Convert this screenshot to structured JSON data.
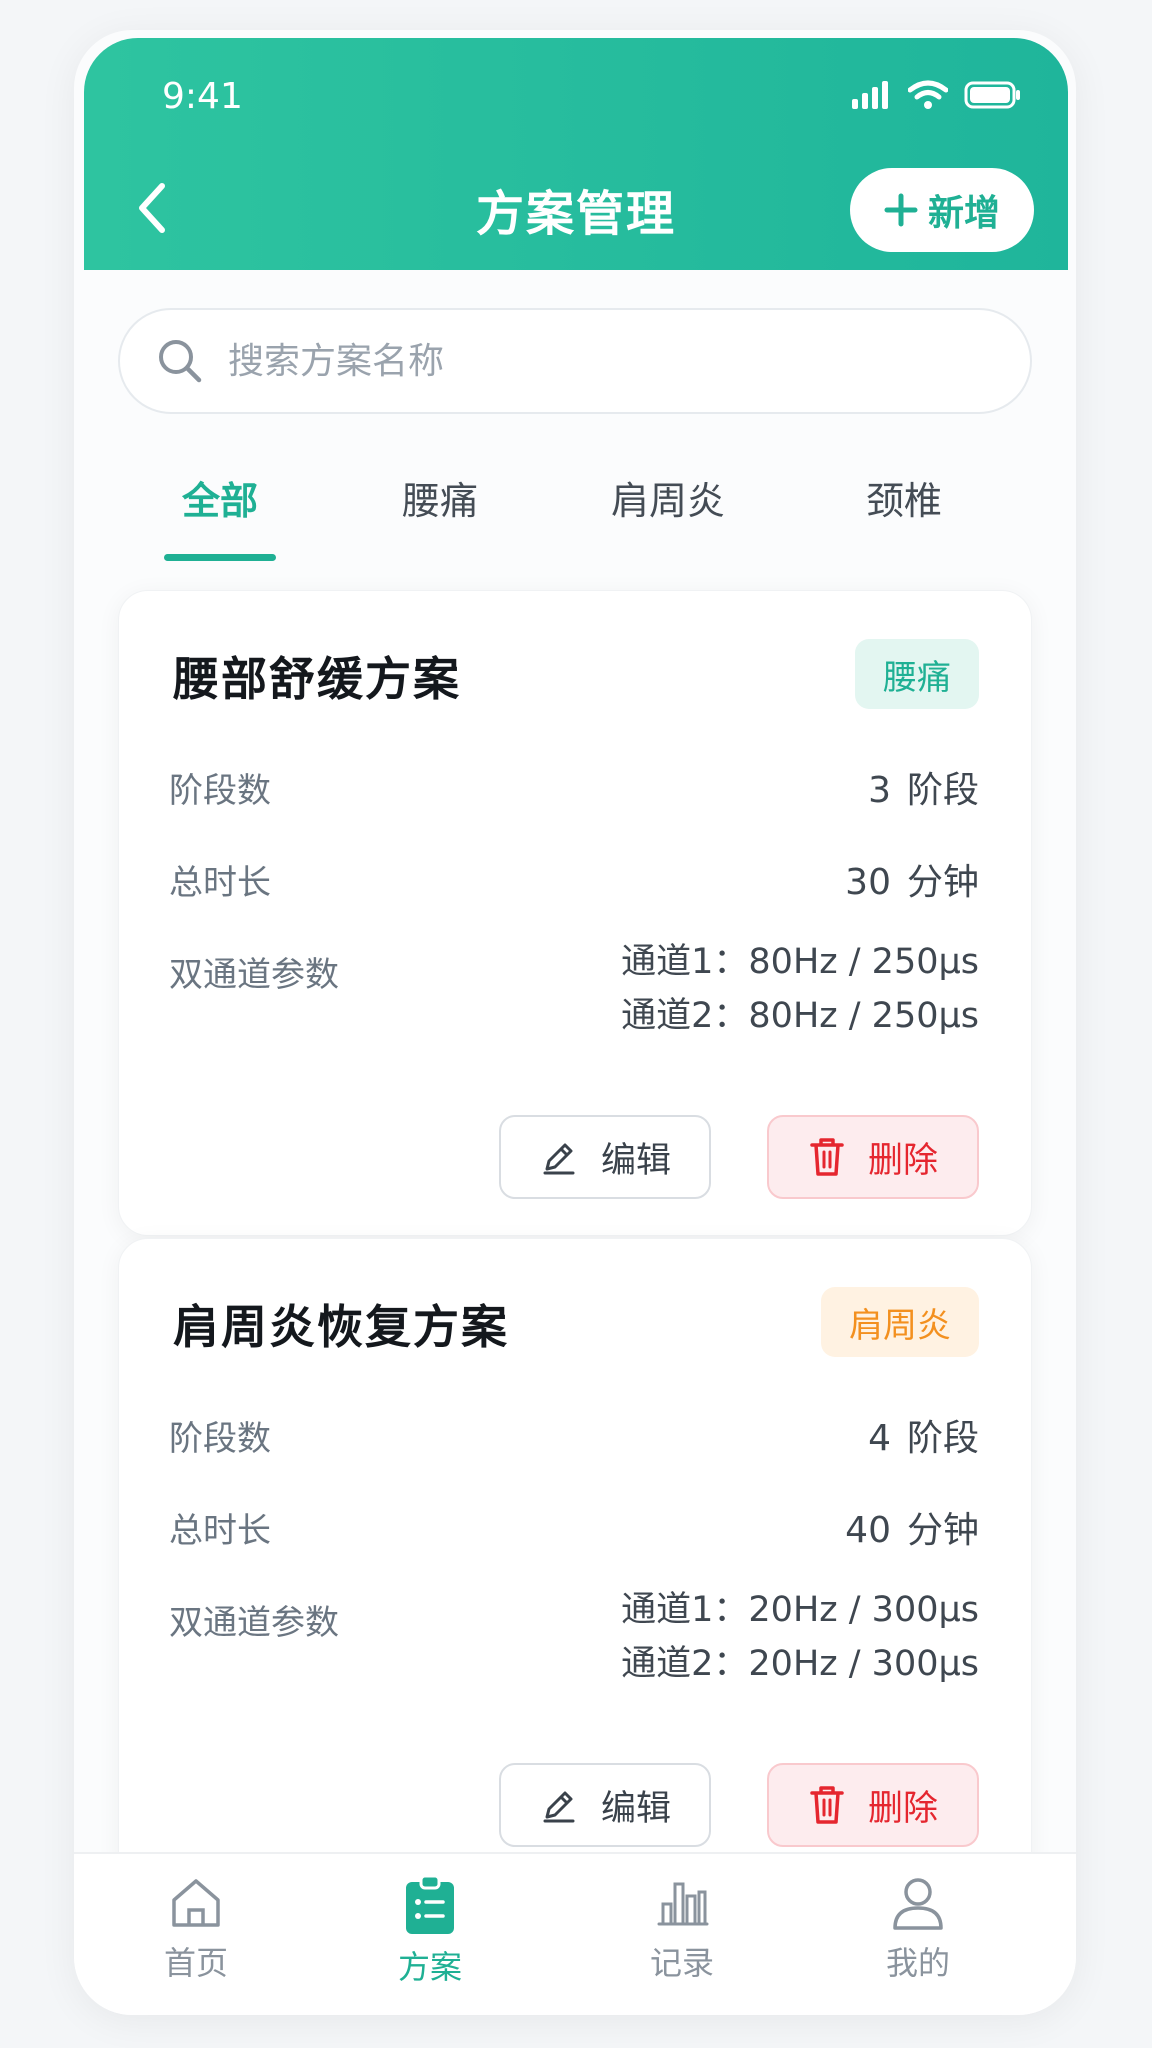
{
  "status_bar": {
    "time": "9:41"
  },
  "nav": {
    "title": "方案管理",
    "add_label": "新增"
  },
  "search": {
    "placeholder": "搜索方案名称",
    "value": ""
  },
  "tabs": [
    {
      "label": "全部",
      "active": true
    },
    {
      "label": "腰痛",
      "active": false
    },
    {
      "label": "肩周炎",
      "active": false
    },
    {
      "label": "颈椎",
      "active": false
    }
  ],
  "plans": [
    {
      "title": "腰部舒缓方案",
      "tag": "腰痛",
      "stages_label": "阶段数",
      "stages_value": "3",
      "stages_unit": "阶段",
      "duration_label": "总时长",
      "duration_value": "30",
      "duration_unit": "分钟",
      "params_label": "双通道参数",
      "channel1": "通道1：80Hz / 250μs",
      "channel2": "通道2：80Hz / 250μs",
      "edit_label": "编辑",
      "delete_label": "删除"
    },
    {
      "title": "肩周炎恢复方案",
      "tag": "肩周炎",
      "stages_label": "阶段数",
      "stages_value": "4",
      "stages_unit": "阶段",
      "duration_label": "总时长",
      "duration_value": "40",
      "duration_unit": "分钟",
      "params_label": "双通道参数",
      "channel1": "通道1：20Hz / 300μs",
      "channel2": "通道2：20Hz / 300μs",
      "edit_label": "编辑",
      "delete_label": "删除"
    }
  ],
  "tabbar": [
    {
      "label": "首页",
      "icon": "home-icon",
      "active": false
    },
    {
      "label": "方案",
      "icon": "clipboard-icon",
      "active": true
    },
    {
      "label": "记录",
      "icon": "bar-chart-icon",
      "active": false
    },
    {
      "label": "我的",
      "icon": "user-icon",
      "active": false
    }
  ],
  "colors": {
    "primary": "#1fb094",
    "danger": "#e5262f",
    "warning": "#f3901f"
  }
}
